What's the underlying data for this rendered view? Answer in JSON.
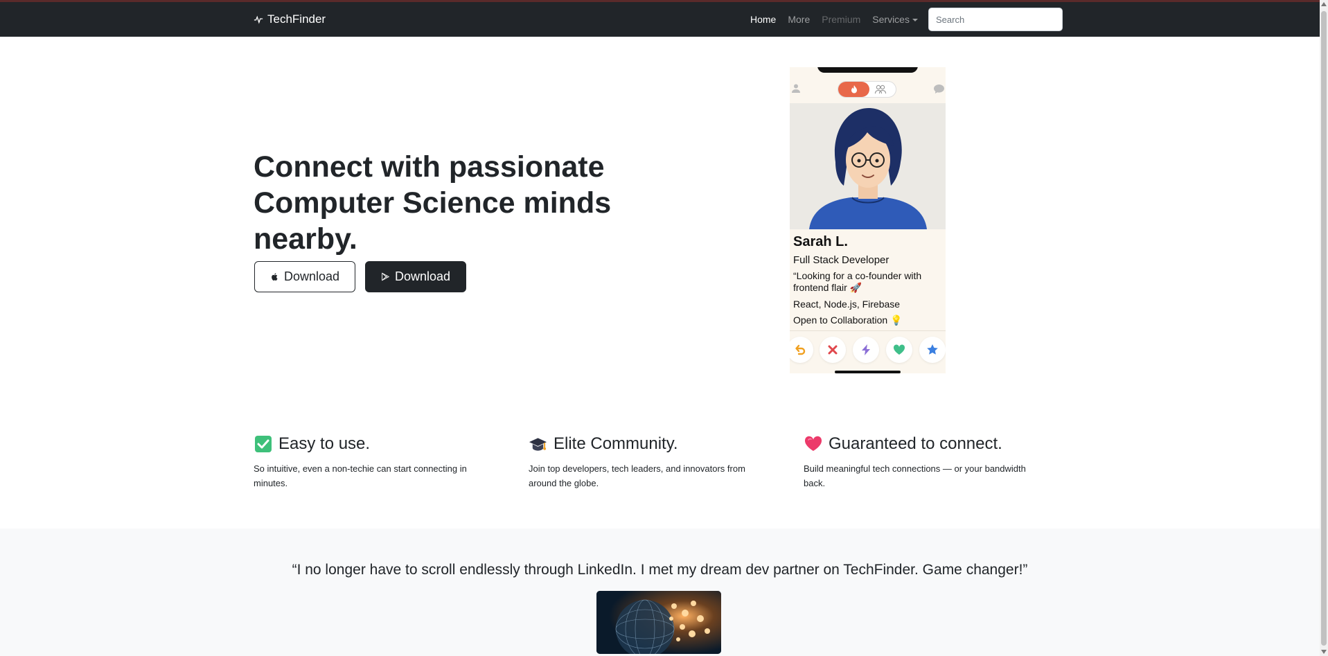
{
  "navbar": {
    "brand": "TechFinder",
    "brand_icon": "pulse-icon",
    "links": [
      {
        "label": "Home",
        "state": "active"
      },
      {
        "label": "More",
        "state": "normal"
      },
      {
        "label": "Premium",
        "state": "disabled"
      },
      {
        "label": "Services",
        "state": "dropdown"
      }
    ],
    "search_placeholder": "Search"
  },
  "hero": {
    "title": "Connect with passionate Computer Science minds nearby.",
    "buttons": [
      {
        "label": "Download",
        "icon": "apple-icon",
        "style": "outline"
      },
      {
        "label": "Download",
        "icon": "google-play-icon",
        "style": "dark"
      }
    ]
  },
  "profile_card": {
    "name": "Sarah L.",
    "role": "Full Stack Developer",
    "quote": "“Looking for a co-founder with frontend flair 🚀",
    "skills": "React, Node.js, Firebase",
    "status": "Open to Collaboration 💡",
    "actions": [
      "undo-icon",
      "close-icon",
      "bolt-icon",
      "heart-icon",
      "star-icon"
    ]
  },
  "features": [
    {
      "icon": "check-mark-icon",
      "title": "Easy to use.",
      "text": "So intuitive, even a non-techie can start connecting in minutes."
    },
    {
      "icon": "graduation-cap-icon",
      "title": "Elite Community.",
      "text": "Join top developers, tech leaders, and innovators from around the globe."
    },
    {
      "icon": "heart-icon",
      "title": "Guaranteed to connect.",
      "text": "Build meaningful tech connections — or your bandwidth back."
    }
  ],
  "testimonial": {
    "quote": "“I no longer have to scroll endlessly through LinkedIn. I met my dream dev partner on TechFinder. Game changer!”"
  },
  "colors": {
    "navbar_bg": "#212529",
    "accent_orange": "#e8684a",
    "testimonial_bg": "#f8f9fa"
  }
}
